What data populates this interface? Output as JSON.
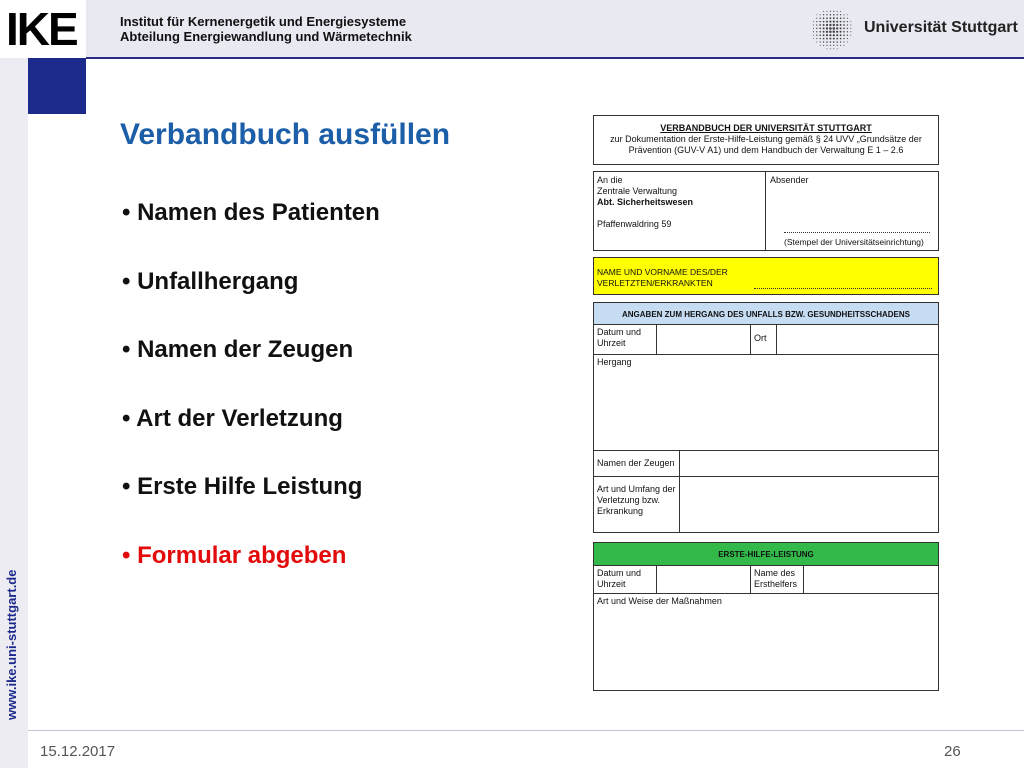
{
  "header": {
    "logo": "IKE",
    "institute_line1": "Institut für Kernenergetik und Energiesysteme",
    "institute_line2": "Abteilung Energiewandlung und Wärmetechnik",
    "university": "Universität Stuttgart"
  },
  "sidebar": {
    "url": "www.ike.uni-stuttgart.de"
  },
  "slide": {
    "title": "Verbandbuch ausfüllen",
    "bullets": [
      "• Namen des Patienten",
      "• Unfallhergang",
      "• Namen der Zeugen",
      "• Art der Verletzung",
      "• Erste Hilfe Leistung",
      "• Formular abgeben"
    ]
  },
  "form": {
    "heading": "VERBANDBUCH DER UNIVERSITÄT STUTTGART",
    "subheading_line1": "zur Dokumentation der Erste-Hilfe-Leistung gemäß § 24 UVV „Grundsätze der",
    "subheading_line2": "Prävention (GUV-V A1) und dem Handbuch der Verwaltung E 1 – 2.6",
    "address_line1": "An die",
    "address_line2": "Zentrale Verwaltung",
    "address_line3": "Abt. Sicherheitswesen",
    "address_line4": "Pfaffenwaldring 59",
    "sender_label": "Absender",
    "stamp_label": "(Stempel der Universitätseinrichtung)",
    "name_label_line1": "NAME UND VORNAME DES/DER",
    "name_label_line2": "VERLETZTEN/ERKRANKTEN",
    "accident_heading": "ANGABEN ZUM HERGANG DES UNFALLS BZW. GESUNDHEITSSCHADENS",
    "date_time_line1": "Datum und",
    "date_time_line2": "Uhrzeit",
    "place": "Ort",
    "course": "Hergang",
    "witnesses": "Namen der Zeugen",
    "injury_line1": "Art und Umfang der",
    "injury_line2": "Verletzung bzw.",
    "injury_line3": "Erkrankung",
    "first_aid_heading": "ERSTE-HILFE-LEISTUNG",
    "fa_date_line1": "Datum und",
    "fa_date_line2": "Uhrzeit",
    "first_aider_line1": "Name des",
    "first_aider_line2": "Ersthelfers",
    "measures": "Art und Weise der Maßnahmen"
  },
  "footer": {
    "date": "15.12.2017",
    "page": "26"
  },
  "colors": {
    "title": "#1c5ea8",
    "accent_blue": "#1c2a8c",
    "highlight_red": "#e20a0a",
    "yellow": "#ffff00",
    "green": "#33b84a"
  }
}
